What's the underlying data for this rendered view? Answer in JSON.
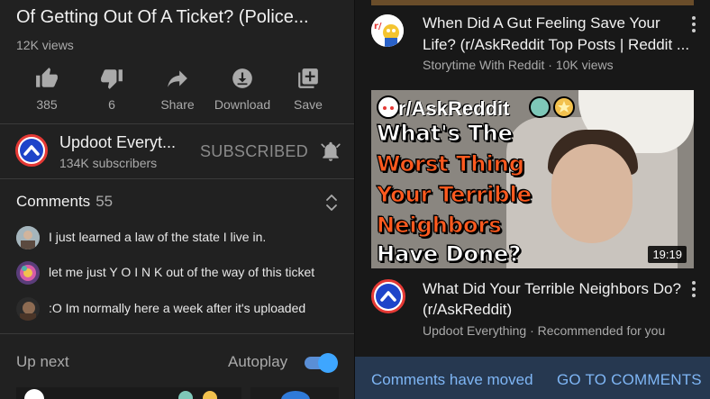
{
  "video": {
    "title": "Of Getting Out Of A Ticket? (Police...",
    "views": "12K views"
  },
  "actions": {
    "like_count": "385",
    "dislike_count": "6",
    "share_label": "Share",
    "download_label": "Download",
    "save_label": "Save"
  },
  "channel": {
    "name": "Updoot Everyt...",
    "subscribers": "134K subscribers",
    "subscribed_label": "SUBSCRIBED"
  },
  "comments": {
    "label": "Comments",
    "count": "55",
    "items": [
      {
        "text": "I just learned a law of the state I live in."
      },
      {
        "text": "let me just Y O I N K out of the way of this ticket"
      },
      {
        "text": ":O Im normally here a week after it's uploaded"
      }
    ]
  },
  "upnext": {
    "label": "Up next",
    "autoplay_label": "Autoplay",
    "autoplay_on": true
  },
  "related": [
    {
      "title": "When Did A Gut Feeling Save Your Life? (r/AskReddit Top Posts | Reddit ...",
      "meta": "Storytime With Reddit · 10K views"
    },
    {
      "title": "What Did Your Terrible Neighbors Do? (r/AskReddit)",
      "meta": "Updoot Everything · Recommended for you",
      "duration": "19:19",
      "thumb_lines": {
        "sub": "r/AskReddit",
        "l1": "What's The",
        "l2": "Worst Thing",
        "l3": "Your Terrible",
        "l4": "Neighbors",
        "l5": "Have Done?"
      }
    }
  ],
  "banner": {
    "message": "Comments have moved",
    "action": "GO TO COMMENTS"
  },
  "colors": {
    "accent_blue": "#3ea6ff",
    "banner_bg": "#263850",
    "thumb_orange": "#ff5a1f"
  }
}
